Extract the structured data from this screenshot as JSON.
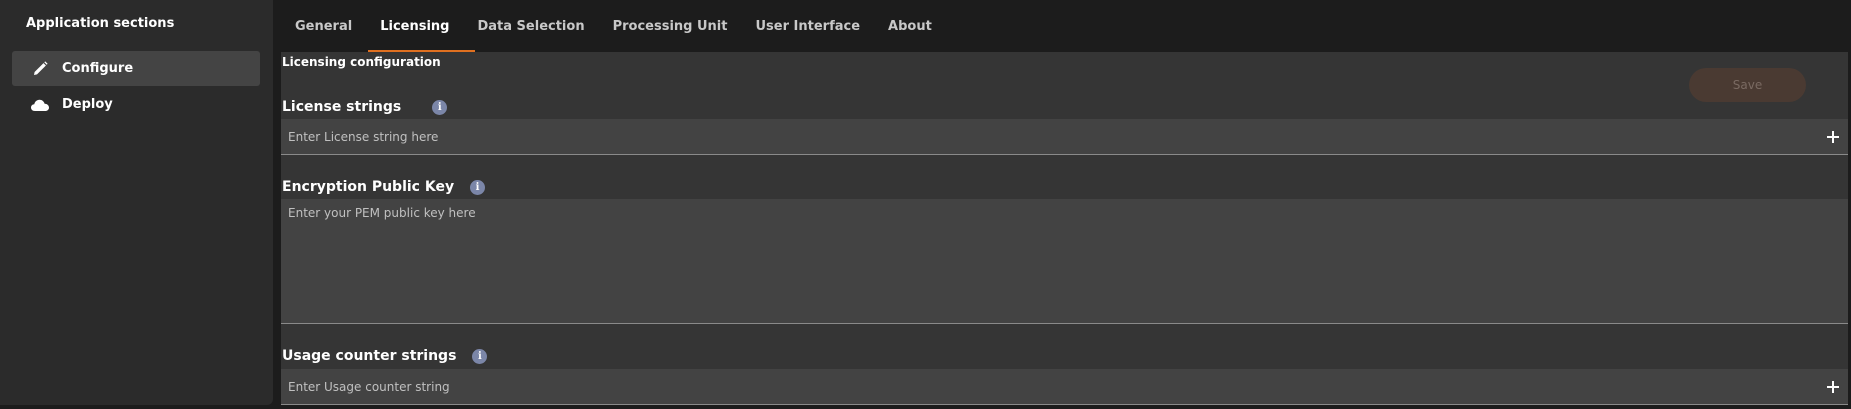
{
  "sidebar": {
    "title": "Application sections",
    "items": [
      {
        "label": "Configure",
        "icon": "pencil-icon",
        "active": true
      },
      {
        "label": "Deploy",
        "icon": "cloud-icon",
        "active": false
      }
    ]
  },
  "tabs": [
    {
      "label": "General",
      "active": false
    },
    {
      "label": "Licensing",
      "active": true
    },
    {
      "label": "Data Selection",
      "active": false
    },
    {
      "label": "Processing Unit",
      "active": false
    },
    {
      "label": "User Interface",
      "active": false
    },
    {
      "label": "About",
      "active": false
    }
  ],
  "main": {
    "heading": "Licensing configuration",
    "save_label": "Save",
    "license_strings": {
      "label": "License strings",
      "placeholder": "Enter License string here"
    },
    "encryption_key": {
      "label": "Encryption Public Key",
      "placeholder": "Enter your PEM public key here"
    },
    "usage_counter": {
      "label": "Usage counter strings",
      "placeholder": "Enter Usage counter string"
    },
    "info_glyph": "i"
  },
  "colors": {
    "accent": "#e07020",
    "info": "#7b86a8",
    "save_disabled_bg": "#4a3a32"
  }
}
